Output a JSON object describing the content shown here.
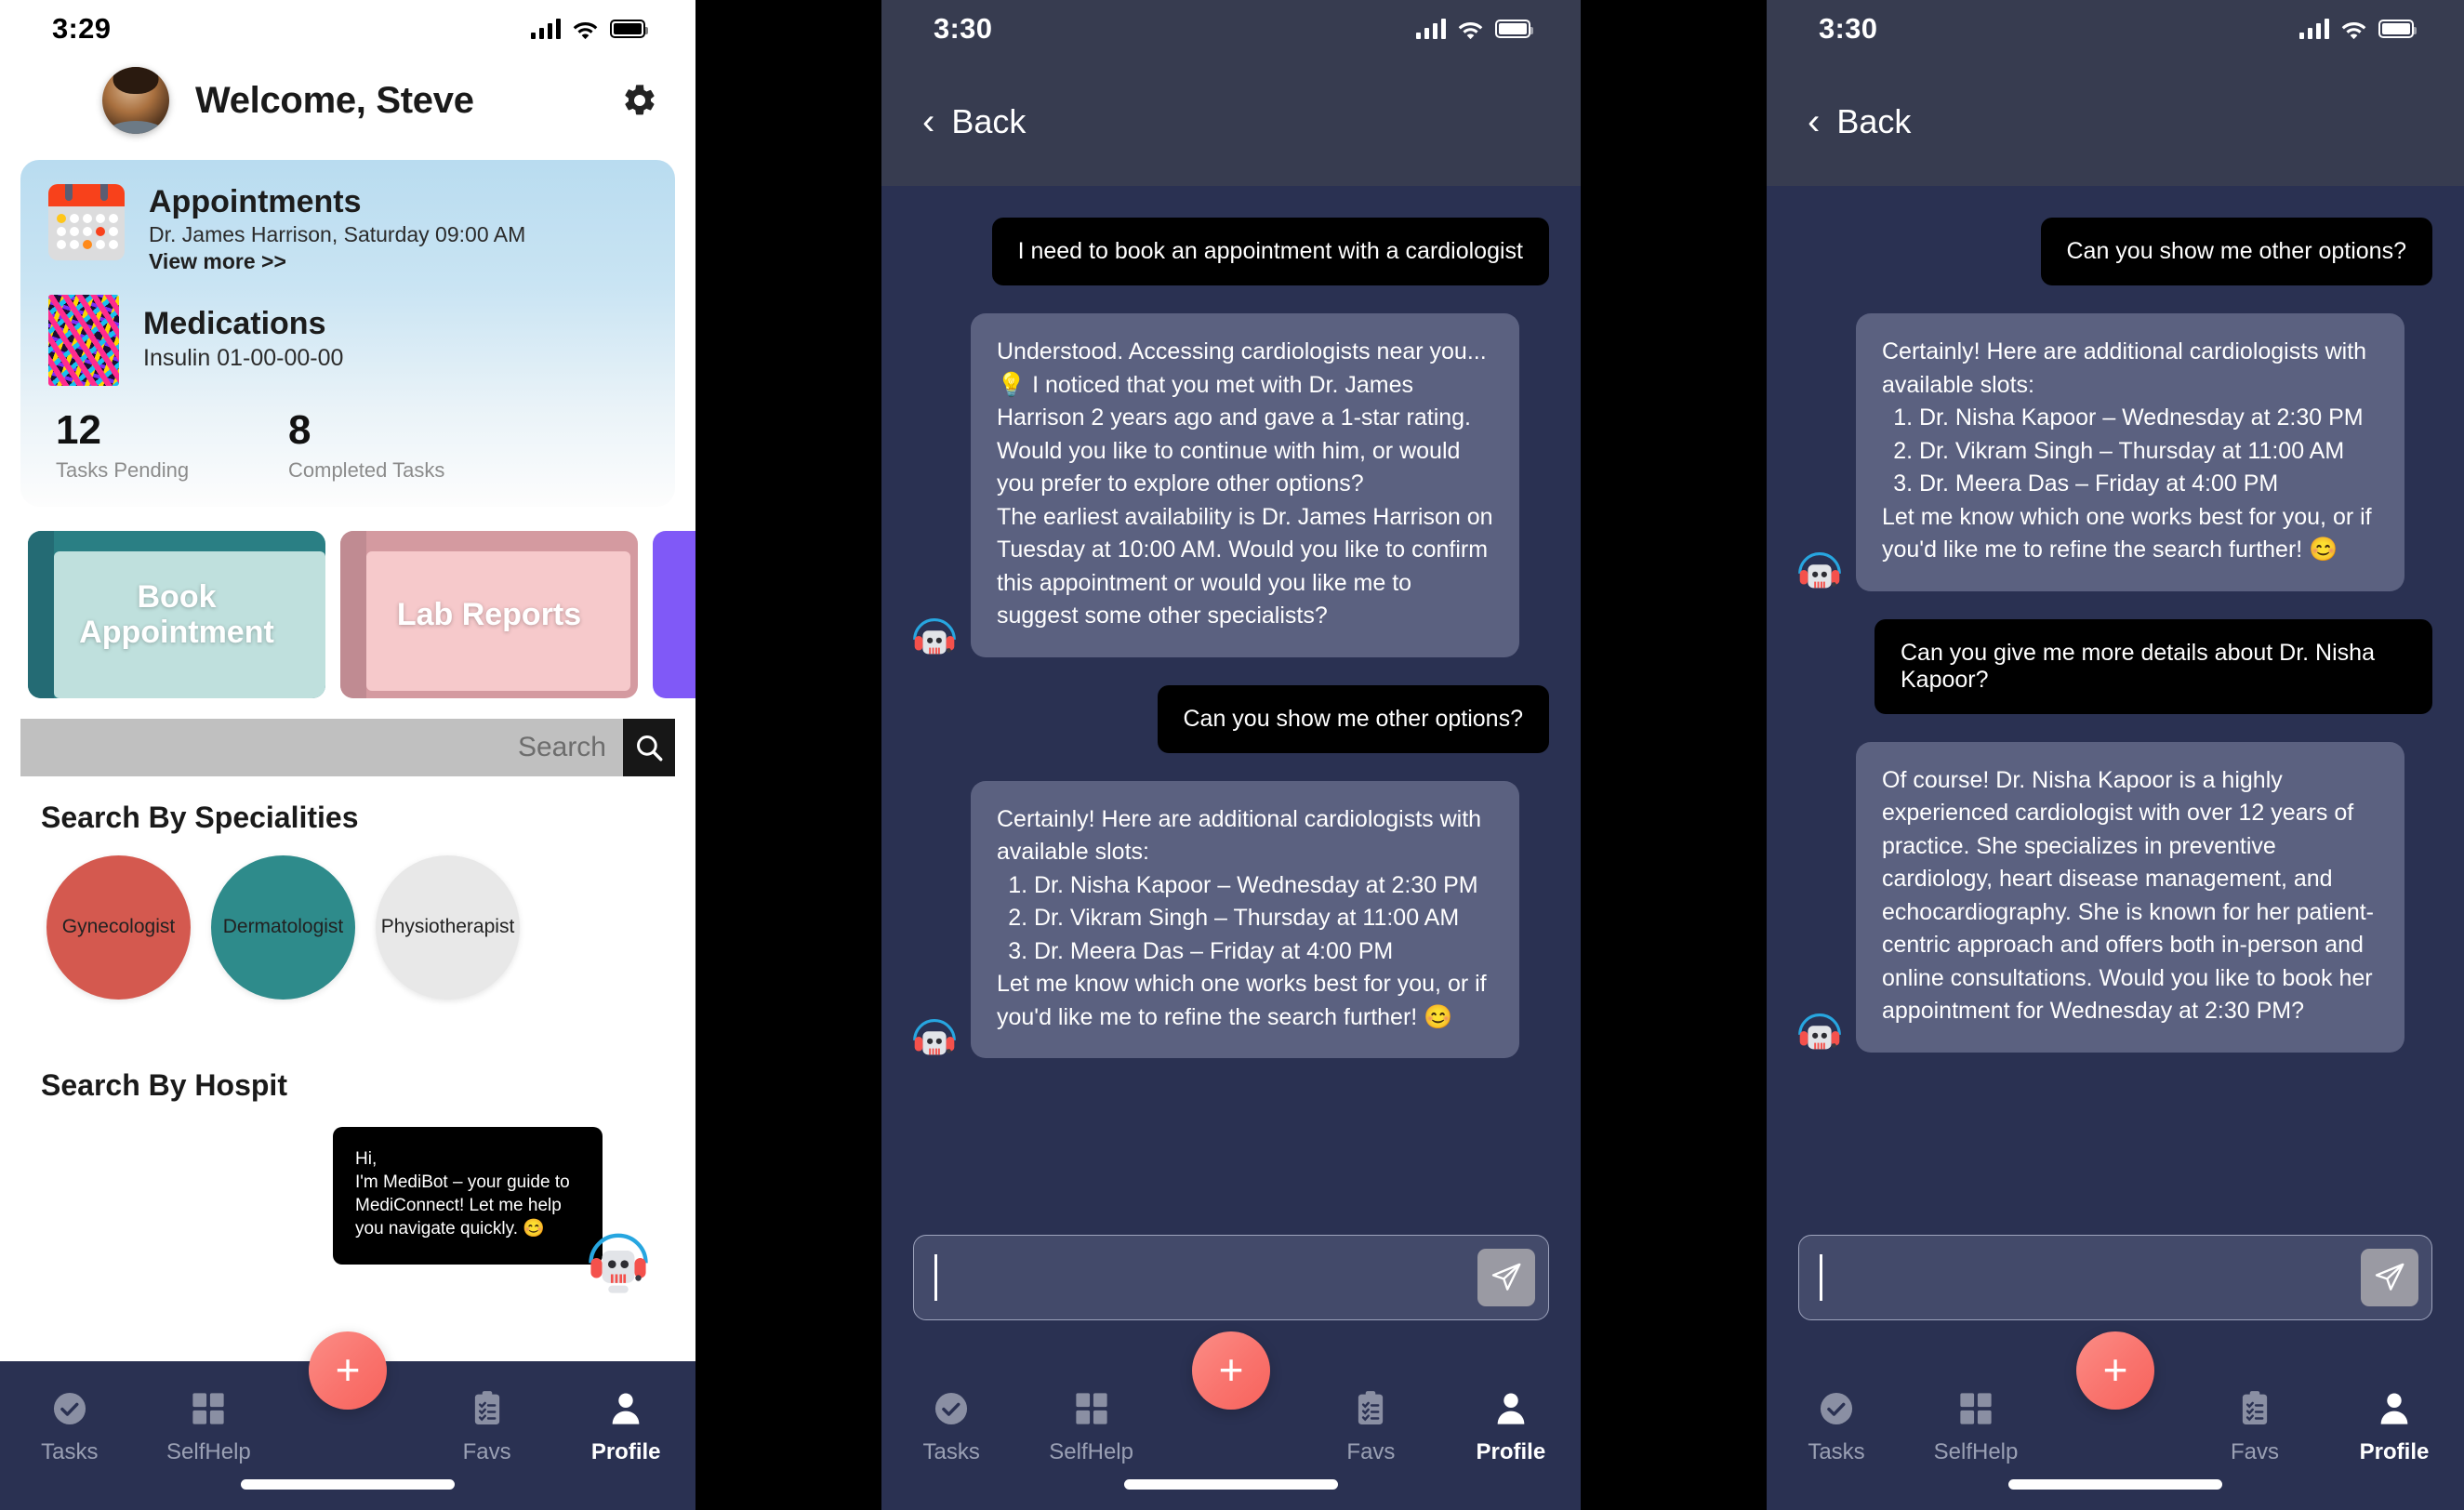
{
  "app": {
    "name": "MediConnect",
    "accent_coral": "#f8635c",
    "nav_bg": "#2a3152",
    "bot_bubble": "#5b6180",
    "user_bubble": "#000000"
  },
  "phone1": {
    "status": {
      "time": "3:29",
      "signal_icon": "cellular-bars-icon",
      "wifi_icon": "wifi-icon",
      "battery_icon": "battery-icon"
    },
    "header": {
      "greeting": "Welcome, Steve",
      "avatar_icon": "user-avatar",
      "settings_icon": "gear-icon"
    },
    "info_card": {
      "appointments": {
        "icon": "calendar-icon",
        "title": "Appointments",
        "subtitle": "Dr. James Harrison, Saturday 09:00 AM",
        "link": "View more >>"
      },
      "medications": {
        "icon": "pills-icon",
        "title": "Medications",
        "subtitle": "Insulin  01-00-00-00"
      },
      "stats": [
        {
          "value": "12",
          "label": "Tasks Pending"
        },
        {
          "value": "8",
          "label": "Completed Tasks"
        }
      ]
    },
    "quick_cards": [
      {
        "label": "Book Appointment"
      },
      {
        "label": "Lab Reports"
      },
      {
        "label": ""
      }
    ],
    "search": {
      "placeholder": "Search",
      "value": "Search",
      "icon": "search-icon"
    },
    "specialities": {
      "title": "Search By Specialities",
      "items": [
        {
          "label": "Gynecologist",
          "color": "#d4594f"
        },
        {
          "label": "Dermatologist",
          "color": "#2e8b8b"
        },
        {
          "label": "Physiotherapist",
          "color": "#e8e8e8"
        }
      ]
    },
    "hospitals": {
      "title": "Search By Hospit"
    },
    "bot_tooltip": {
      "line1": "Hi,",
      "line2": "I'm MediBot – your guide to MediConnect! Let me help you navigate quickly. 😊",
      "icon": "robot-headset-icon"
    },
    "tabbar": {
      "fab_label": "+",
      "items": [
        {
          "label": "Tasks",
          "icon": "check-circle-icon",
          "active": false
        },
        {
          "label": "SelfHelp",
          "icon": "grid-icon",
          "active": false
        },
        {
          "label": "Favs",
          "icon": "clipboard-checklist-icon",
          "active": false
        },
        {
          "label": "Profile",
          "icon": "person-icon",
          "active": true
        }
      ]
    }
  },
  "phone2": {
    "status": {
      "time": "3:30"
    },
    "nav": {
      "back_label": "Back",
      "back_icon": "chevron-left-icon"
    },
    "messages": [
      {
        "from": "user",
        "text": "I need to book an appointment with a cardiologist"
      },
      {
        "from": "bot",
        "para1": "Understood. Accessing cardiologists near you... 💡 I noticed that you met with Dr. James Harrison 2 years ago and gave a 1-star rating. Would you like to continue with him, or would you prefer to explore other options?",
        "para2": "The earliest availability is Dr. James Harrison on Tuesday at 10:00 AM. Would you like to confirm this appointment or would you like me to suggest some other specialists?"
      },
      {
        "from": "user",
        "text": "Can you show me other options?"
      },
      {
        "from": "bot",
        "para1": "Certainly! Here are additional cardiologists with available slots:",
        "list": [
          "Dr. Nisha Kapoor – Wednesday at 2:30 PM",
          "Dr. Vikram Singh – Thursday at 11:00 AM",
          "Dr. Meera Das – Friday at 4:00 PM"
        ],
        "para2": "Let me know which one works best for you, or if you'd like me to refine the search further! 😊"
      }
    ],
    "composer": {
      "placeholder": "",
      "value": "",
      "send_icon": "send-paper-plane-icon"
    },
    "tabbar": {
      "fab_label": "+",
      "items": [
        {
          "label": "Tasks",
          "icon": "check-circle-icon",
          "active": false
        },
        {
          "label": "SelfHelp",
          "icon": "grid-icon",
          "active": false
        },
        {
          "label": "Favs",
          "icon": "clipboard-checklist-icon",
          "active": false
        },
        {
          "label": "Profile",
          "icon": "person-icon",
          "active": true
        }
      ]
    }
  },
  "phone3": {
    "status": {
      "time": "3:30"
    },
    "nav": {
      "back_label": "Back",
      "back_icon": "chevron-left-icon"
    },
    "messages": [
      {
        "from": "user",
        "text": "Can you show me other options?"
      },
      {
        "from": "bot",
        "para1": "Certainly! Here are additional cardiologists with available slots:",
        "list": [
          "Dr. Nisha Kapoor – Wednesday at 2:30 PM",
          "Dr. Vikram Singh – Thursday at 11:00 AM",
          "Dr. Meera Das – Friday at 4:00 PM"
        ],
        "para2": "Let me know which one works best for you, or if you'd like me to refine the search further! 😊"
      },
      {
        "from": "user",
        "text": "Can you give me more details about Dr. Nisha Kapoor?"
      },
      {
        "from": "bot",
        "para1": "Of course! Dr. Nisha Kapoor is a highly experienced cardiologist with over 12 years of practice. She specializes in preventive cardiology, heart disease management, and echocardiography. She is known for her patient-centric approach and offers both in-person and online consultations. Would you like to book her appointment for Wednesday at 2:30 PM?"
      }
    ],
    "composer": {
      "placeholder": "",
      "value": "",
      "send_icon": "send-paper-plane-icon"
    },
    "tabbar": {
      "fab_label": "+",
      "items": [
        {
          "label": "Tasks",
          "icon": "check-circle-icon",
          "active": false
        },
        {
          "label": "SelfHelp",
          "icon": "grid-icon",
          "active": false
        },
        {
          "label": "Favs",
          "icon": "clipboard-checklist-icon",
          "active": false
        },
        {
          "label": "Profile",
          "icon": "person-icon",
          "active": true
        }
      ]
    }
  }
}
